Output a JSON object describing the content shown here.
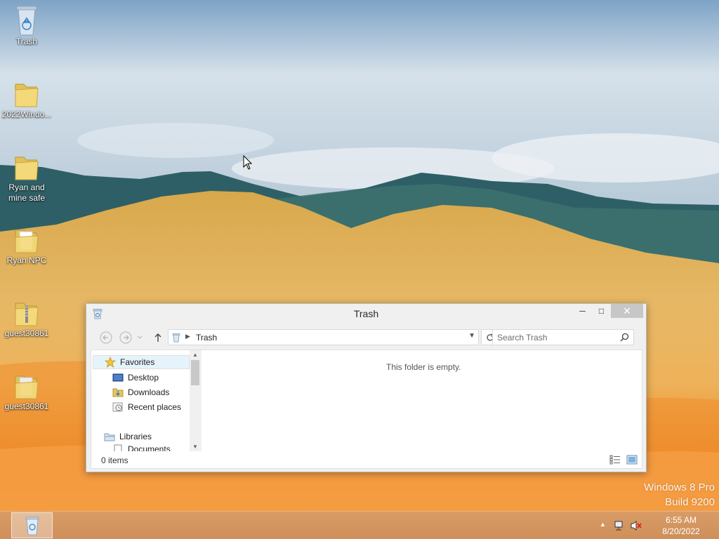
{
  "desktop": {
    "icons": [
      {
        "label": "Trash",
        "icon": "recycle-bin-icon"
      },
      {
        "label": "2022Windo...",
        "icon": "folder-icon"
      },
      {
        "label": "Ryan and mine safe",
        "icon": "folder-icon"
      },
      {
        "label": "Ryan NPC",
        "icon": "folder-icon"
      },
      {
        "label": "guest30861",
        "icon": "zip-folder-icon"
      },
      {
        "label": "guest30861",
        "icon": "folder-icon"
      }
    ],
    "watermark": {
      "line1": "Windows 8 Pro",
      "line2": "Build 9200"
    }
  },
  "window": {
    "title": "Trash",
    "controls": {
      "minimize": "─",
      "maximize": "□",
      "close": "✕"
    },
    "address": {
      "path": "Trash"
    },
    "search": {
      "placeholder": "Search Trash"
    },
    "nav_pane": {
      "favorites": "Favorites",
      "items": [
        "Desktop",
        "Downloads",
        "Recent places"
      ],
      "libraries": "Libraries",
      "libraries_child_cut": "Documents"
    },
    "empty_message": "This folder is empty.",
    "status": "0 items"
  },
  "taskbar": {
    "pinned": [
      {
        "name": "Trash",
        "icon": "recycle-bin-icon"
      }
    ],
    "clock": {
      "time": "6:55 AM",
      "date": "8/20/2022"
    }
  },
  "colors": {
    "taskbar": "#d59862",
    "close_button": "#c7c7c7",
    "selection": "#e5f3fb"
  }
}
